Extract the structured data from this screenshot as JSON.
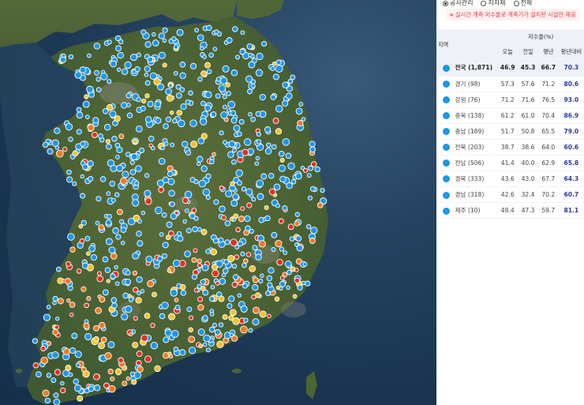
{
  "filters": [
    {
      "label": "공사관리",
      "checked": true
    },
    {
      "label": "지자체",
      "checked": false
    },
    {
      "label": "전체",
      "checked": false
    }
  ],
  "notice": "실시간 계측 저수율로 계측기가 설치된 시설만 제공",
  "table": {
    "region_header": "지역",
    "group_header": "저수율(%)",
    "columns": [
      "오늘",
      "전일",
      "평년",
      "평년대비"
    ],
    "rows": [
      {
        "region": "전국 (1,871)",
        "today": "46.9",
        "prev": "45.3",
        "normal": "66.7",
        "vs": "70.3"
      },
      {
        "region": "경기 (98)",
        "today": "57.3",
        "prev": "57.6",
        "normal": "71.2",
        "vs": "80.6"
      },
      {
        "region": "강원 (76)",
        "today": "71.2",
        "prev": "71.6",
        "normal": "76.5",
        "vs": "93.0"
      },
      {
        "region": "충북 (138)",
        "today": "61.2",
        "prev": "61.0",
        "normal": "70.4",
        "vs": "86.9"
      },
      {
        "region": "충남 (189)",
        "today": "51.7",
        "prev": "50.8",
        "normal": "65.5",
        "vs": "79.0"
      },
      {
        "region": "전북 (203)",
        "today": "38.7",
        "prev": "38.6",
        "normal": "64.0",
        "vs": "60.6"
      },
      {
        "region": "전남 (506)",
        "today": "41.4",
        "prev": "40.0",
        "normal": "62.9",
        "vs": "65.8"
      },
      {
        "region": "경북 (333)",
        "today": "43.6",
        "prev": "43.0",
        "normal": "67.7",
        "vs": "64.3"
      },
      {
        "region": "경남 (318)",
        "today": "42.6",
        "prev": "32.4",
        "normal": "70.2",
        "vs": "60.7"
      },
      {
        "region": "제주 (10)",
        "today": "48.4",
        "prev": "47.3",
        "normal": "59.7",
        "vs": "81.1"
      }
    ]
  },
  "colors": {
    "marker_blue": "#1e96ea",
    "marker_yellow": "#f2c230",
    "marker_orange": "#f07a22",
    "marker_red": "#e03222",
    "accent_text": "#2a3aa3",
    "notice_text": "#e23b3b"
  }
}
